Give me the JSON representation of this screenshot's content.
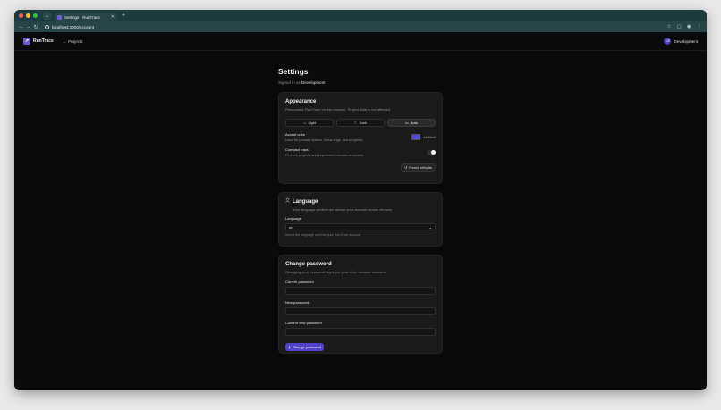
{
  "browser": {
    "tab_title": "Settings · RunTrace",
    "url": "localhost:3000/account"
  },
  "app": {
    "brand": "RunTrace",
    "projects_link": "Projects",
    "user": {
      "initials": "DE",
      "name": "Development"
    }
  },
  "page": {
    "title": "Settings",
    "signed_in_prefix": "Signed in as",
    "signed_in_user": "Development"
  },
  "appearance": {
    "title": "Appearance",
    "description": "Personalize RunTrace on this browser. Project data is not affected.",
    "themes": [
      {
        "label": "Light",
        "icon": "sun-icon",
        "active": false
      },
      {
        "label": "Dark",
        "icon": "moon-icon",
        "active": false
      },
      {
        "label": "Auto",
        "icon": "monitor-icon",
        "active": true
      }
    ],
    "accent": {
      "label": "Accent color",
      "sub": "Used for primary actions, focus rings, and progress.",
      "value": "#4f46e5"
    },
    "compact": {
      "label": "Compact rows",
      "sub": "Fit more projects and experiment records on screen.",
      "enabled": true
    },
    "reset_label": "Reset defaults"
  },
  "language": {
    "title": "Language",
    "description": "Your language preference follows your account across devices.",
    "field_label": "Language",
    "selected": "en",
    "hint": "Select the language used for your RunTrace account."
  },
  "password": {
    "title": "Change password",
    "description": "Changing your password signs out your other browser sessions.",
    "current_label": "Current password",
    "new_label": "New password",
    "confirm_label": "Confirm new password",
    "submit_label": "Change password"
  },
  "colors": {
    "accent": "#4f46e5",
    "tab_strip": "#1d3a3c",
    "background": "#0a0a0a",
    "card": "#1a1a1a"
  }
}
